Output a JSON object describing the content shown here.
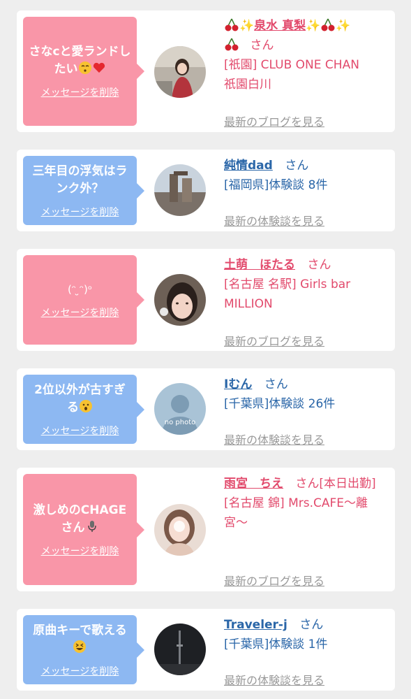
{
  "colors": {
    "pink_bubble": "#f996a8",
    "blue_bubble": "#8db8f2",
    "pink_text": "#e24a6c",
    "blue_text": "#2a66a8",
    "gray_link": "#999999",
    "background": "#eeeeee"
  },
  "cards": [
    {
      "message": "さなcと愛ランドしたい",
      "message_emoji": [
        "kissing-face-icon",
        "red-heart-icon"
      ],
      "delete_label": "メッセージを削除",
      "name": "泉水 真梨",
      "name_decor": [
        "cherry-icon",
        "sparkle-icon"
      ],
      "san": "さん",
      "detail_lines": [
        "[祇園] CLUB ONE CHAN",
        "祇園白川"
      ],
      "more_link": "最新のブログを見る"
    },
    {
      "message": "三年目の浮気はランク外？",
      "delete_label": "メッセージを削除",
      "name": "純情dad",
      "san": "さん",
      "detail_lines": [
        "[福岡県]体験談 8件"
      ],
      "more_link": "最新の体験談を見る"
    },
    {
      "message": "(ᵔ ̮ᵔ)ᵒ",
      "delete_label": "メッセージを削除",
      "name": "土萌　ほたる",
      "san": "さん",
      "detail_lines": [
        "[名古屋 名駅] Girls bar",
        "MILLION"
      ],
      "more_link": "最新のブログを見る"
    },
    {
      "message": "2位以外が古すぎる",
      "message_emoji": [
        "astonished-face-icon"
      ],
      "delete_label": "メッセージを削除",
      "name": "Iむん",
      "san": "さん",
      "detail_lines": [
        "[千葉県]体験談 26件"
      ],
      "more_link": "最新の体験談を見る",
      "avatar_text": "no photo"
    },
    {
      "message": "激しめのCHAGEさん",
      "message_emoji": [
        "microphone-icon"
      ],
      "delete_label": "メッセージを削除",
      "name": "雨宮　ちえ",
      "san": "さん",
      "san_suffix": "[本日出勤]",
      "detail_lines": [
        "[名古屋 錦] Mrs.CAFE〜離宮〜"
      ],
      "more_link": "最新のブログを見る"
    },
    {
      "message": "原曲キーで歌える",
      "message_emoji": [
        "grinning-squinting-face-icon"
      ],
      "delete_label": "メッセージを削除",
      "name": "Traveler-j",
      "san": "さん",
      "detail_lines": [
        "[千葉県]体験談 1件"
      ],
      "more_link": "最新の体験談を見る"
    }
  ]
}
